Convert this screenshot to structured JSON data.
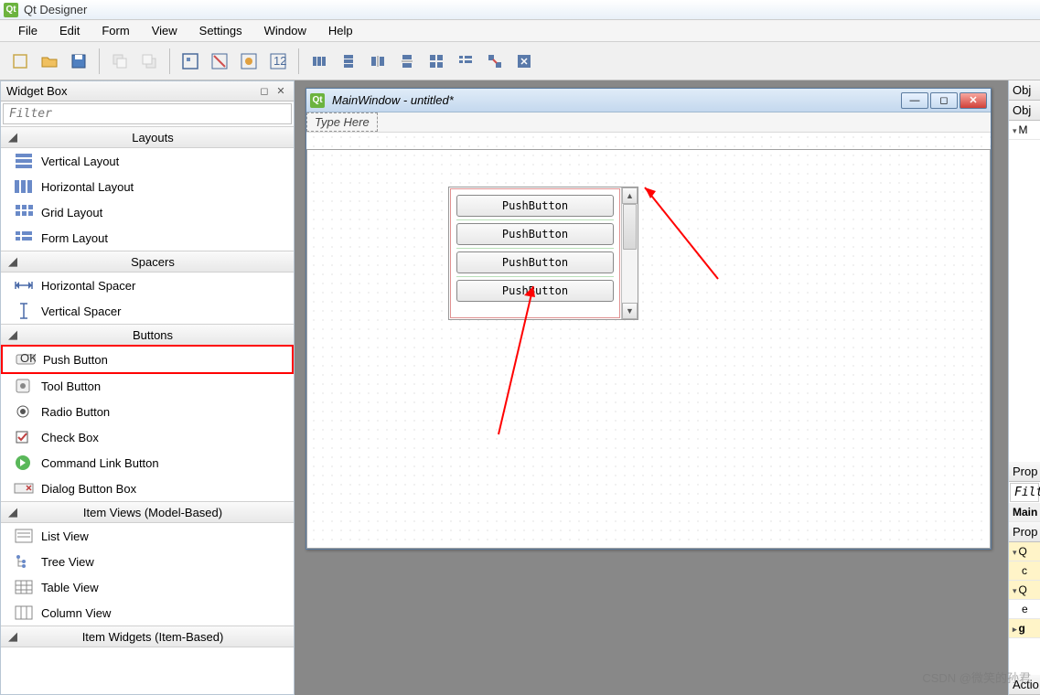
{
  "app": {
    "title": "Qt Designer"
  },
  "menu": {
    "items": [
      "File",
      "Edit",
      "Form",
      "View",
      "Settings",
      "Window",
      "Help"
    ]
  },
  "widget_box": {
    "title": "Widget Box",
    "filter_placeholder": "Filter",
    "sections": {
      "layouts": {
        "label": "Layouts",
        "items": [
          "Vertical Layout",
          "Horizontal Layout",
          "Grid Layout",
          "Form Layout"
        ]
      },
      "spacers": {
        "label": "Spacers",
        "items": [
          "Horizontal Spacer",
          "Vertical Spacer"
        ]
      },
      "buttons": {
        "label": "Buttons",
        "items": [
          "Push Button",
          "Tool Button",
          "Radio Button",
          "Check Box",
          "Command Link Button",
          "Dialog Button Box"
        ]
      },
      "item_views": {
        "label": "Item Views (Model-Based)",
        "items": [
          "List View",
          "Tree View",
          "Table View",
          "Column View"
        ]
      },
      "item_widgets": {
        "label": "Item Widgets (Item-Based)"
      }
    }
  },
  "mdi": {
    "title": "MainWindow - untitled*",
    "type_here": "Type Here",
    "buttons": [
      "PushButton",
      "PushButton",
      "PushButton",
      "PushButton"
    ]
  },
  "right": {
    "object_inspector": "Obj",
    "obj2": "Obj",
    "m": "M",
    "property_editor": "Prop",
    "filter": "Filt",
    "main": "Main",
    "prop2": "Prop",
    "q": "Q",
    "c": "c",
    "e": "e",
    "g": "g",
    "action": "Actio"
  },
  "watermark": "CSDN @微笑的孙君"
}
